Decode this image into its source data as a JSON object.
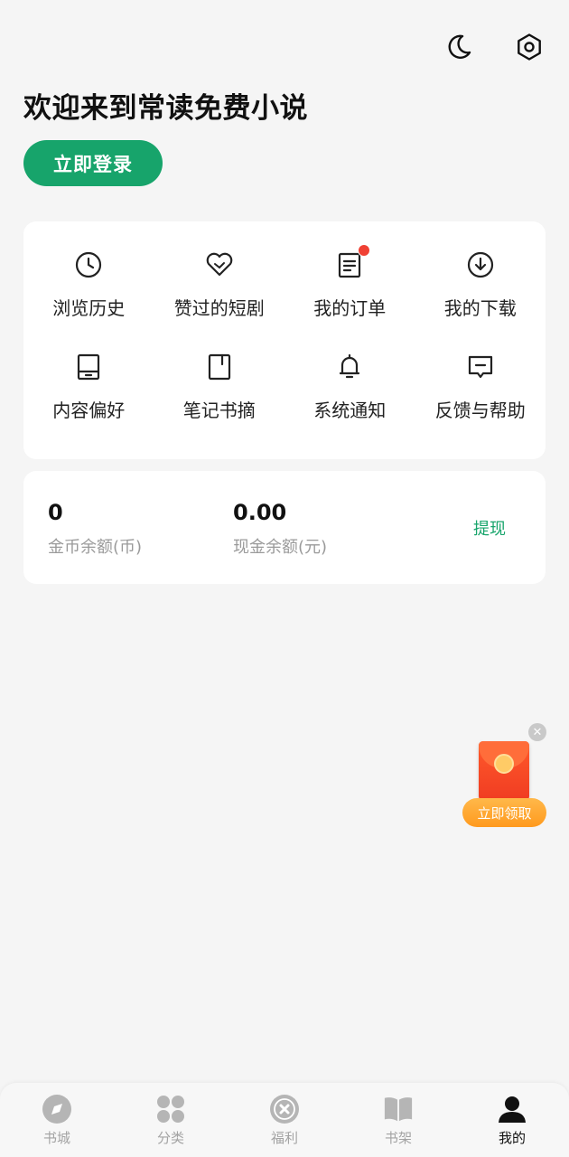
{
  "header": {
    "night_mode_icon": "moon-icon",
    "settings_icon": "gear-icon",
    "welcome": "欢迎来到常读免费小说",
    "login_label": "立即登录"
  },
  "menu": [
    {
      "label": "浏览历史",
      "icon": "clock-icon"
    },
    {
      "label": "赞过的短剧",
      "icon": "heart-icon"
    },
    {
      "label": "我的订单",
      "icon": "order-icon",
      "badge": true
    },
    {
      "label": "我的下载",
      "icon": "download-icon"
    },
    {
      "label": "内容偏好",
      "icon": "tablet-icon"
    },
    {
      "label": "笔记书摘",
      "icon": "notebook-icon"
    },
    {
      "label": "系统通知",
      "icon": "bell-icon"
    },
    {
      "label": "反馈与帮助",
      "icon": "feedback-icon"
    }
  ],
  "balance": {
    "coin_value": "0",
    "coin_label": "金币余额(币)",
    "cash_value": "0.00",
    "cash_label": "现金余额(元)",
    "withdraw_label": "提现"
  },
  "promo": {
    "claim_label": "立即领取"
  },
  "tabbar": [
    {
      "label": "书城",
      "icon": "compass-icon"
    },
    {
      "label": "分类",
      "icon": "grid-icon"
    },
    {
      "label": "福利",
      "icon": "gift-icon"
    },
    {
      "label": "书架",
      "icon": "book-icon"
    },
    {
      "label": "我的",
      "icon": "user-icon",
      "active": true
    }
  ],
  "colors": {
    "accent": "#17a46b",
    "badge": "#f04134",
    "background": "#f5f5f5"
  }
}
